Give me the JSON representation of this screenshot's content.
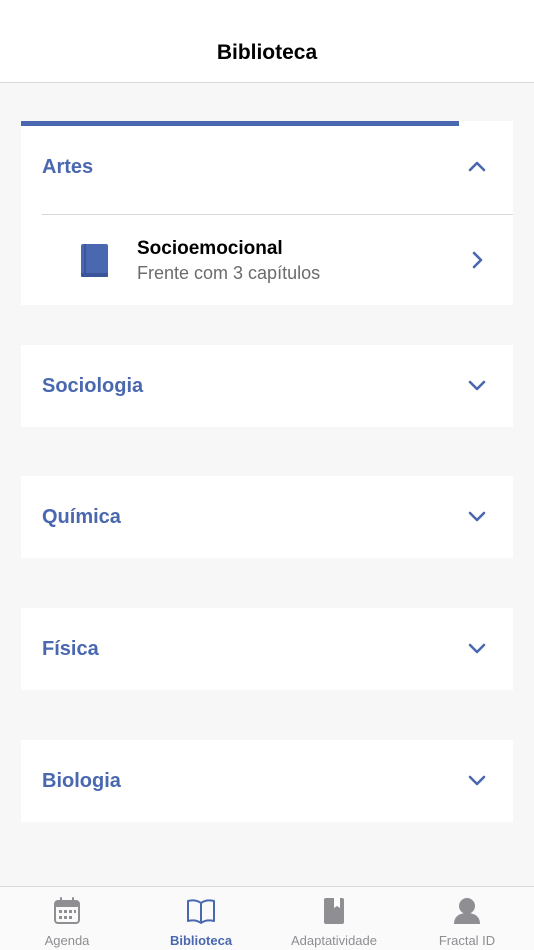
{
  "header": {
    "title": "Biblioteca"
  },
  "progress": {
    "fraction": 0.89
  },
  "subjects": [
    {
      "name": "Artes",
      "expanded": true,
      "books": [
        {
          "title": "Socioemocional",
          "subtitle": "Frente com 3 capítulos"
        }
      ]
    },
    {
      "name": "Sociologia",
      "expanded": false
    },
    {
      "name": "Química",
      "expanded": false
    },
    {
      "name": "Física",
      "expanded": false
    },
    {
      "name": "Biologia",
      "expanded": false
    }
  ],
  "tabs": [
    {
      "label": "Agenda",
      "icon": "calendar-icon",
      "active": false
    },
    {
      "label": "Biblioteca",
      "icon": "open-book-icon",
      "active": true
    },
    {
      "label": "Adaptatividade",
      "icon": "bookmark-book-icon",
      "active": false
    },
    {
      "label": "Fractal ID",
      "icon": "profile-icon",
      "active": false
    }
  ],
  "colors": {
    "accent": "#4a68b0",
    "inactive": "#8e8e93",
    "background": "#f7f7f7"
  }
}
